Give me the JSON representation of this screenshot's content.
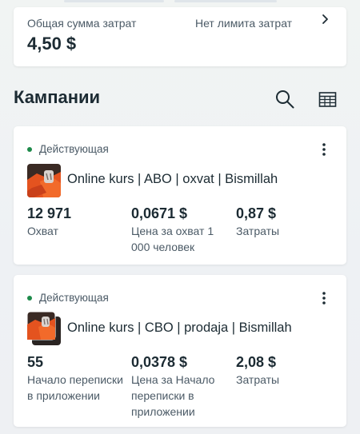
{
  "summary": {
    "total_label": "Общая сумма затрат",
    "total_value": "4,50 $",
    "limit_label": "Нет лимита затрат"
  },
  "section": {
    "title": "Кампании"
  },
  "campaigns": [
    {
      "status": "Действующая",
      "name": "Online kurs | ABO | oxvat | Bismillah",
      "metrics": [
        {
          "value": "12 971",
          "label": "Охват"
        },
        {
          "value": "0,0671 $",
          "label": "Цена за охват 1 000 человек"
        },
        {
          "value": "0,87 $",
          "label": "Затраты"
        }
      ]
    },
    {
      "status": "Действующая",
      "name": "Online kurs | CBO | prodaja | Bismillah",
      "metrics": [
        {
          "value": "55",
          "label": "Начало переписки в приложении"
        },
        {
          "value": "0,0378 $",
          "label": "Цена за Начало переписки в приложении"
        },
        {
          "value": "2,08 $",
          "label": "Затраты"
        }
      ]
    }
  ],
  "colors": {
    "status_active": "#1d8a4a",
    "text": "#1c2b33",
    "muted": "#4b5a66"
  },
  "icons": [
    "chevron-right-icon",
    "search-icon",
    "table-icon",
    "more-vertical-icon"
  ]
}
